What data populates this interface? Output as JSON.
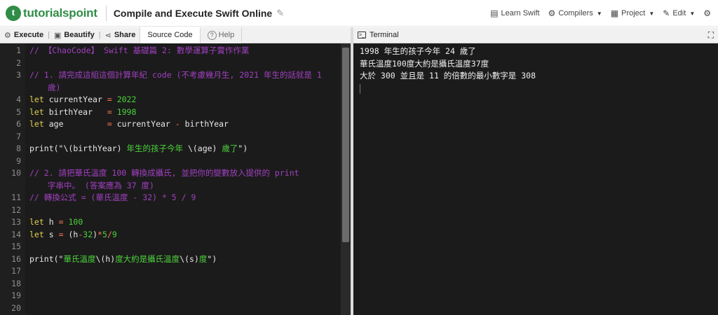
{
  "header": {
    "logo_text": "tutorialspoint",
    "title": "Compile and Execute Swift Online",
    "nav": [
      {
        "label": "Learn Swift",
        "icon": "book-icon"
      },
      {
        "label": "Compilers",
        "icon": "gear-icon"
      },
      {
        "label": "Project",
        "icon": "grid-icon"
      },
      {
        "label": "Edit",
        "icon": "edit-icon"
      }
    ]
  },
  "toolbar": {
    "execute_label": "Execute",
    "beautify_label": "Beautify",
    "share_label": "Share",
    "source_code_tab": "Source Code",
    "help_tab": "Help"
  },
  "terminal": {
    "title": "Terminal",
    "output": [
      "1998 年生的孩子今年 24 歲了",
      "華氏溫度100度大約是攝氏溫度37度",
      "大於 300 並且是 11 的倍數的最小數字是 308"
    ]
  },
  "editor": {
    "line_numbers": [
      "1",
      "2",
      "3",
      "4",
      "5",
      "6",
      "7",
      "8",
      "9",
      "10",
      "11",
      "12",
      "13",
      "14",
      "15",
      "16",
      "17",
      "18",
      "19",
      "20"
    ],
    "lines": {
      "l1": "// 【ChaoCode】 Swift 基礎篇 2: 數學運算子實作作業",
      "l3a": "// 1. 請完成這組這個計算年紀 code (不考慮幾月生, 2021 年生的話就是 1",
      "l3b": "歲)",
      "l4_kw": "let",
      "l4_id": "currentYear",
      "l4_op": "=",
      "l4_num": "2022",
      "l5_kw": "let",
      "l5_id": "birthYear",
      "l5_op": "=",
      "l5_num": "1998",
      "l6_kw": "let",
      "l6_id": "age",
      "l6_op": "=",
      "l6_a": "currentYear",
      "l6_minus": "-",
      "l6_b": "birthYear",
      "l8_fn": "print(",
      "l8_q": "\"",
      "l8_i1": "\\(birthYear)",
      "l8_s1": " 年生的孩子今年 ",
      "l8_i2": "\\(age)",
      "l8_s2": " 歲了",
      "l8_end": "\")",
      "l10a": "// 2. 請把華氏溫度 100 轉換成攝氏, 並把你的變數放入提供的 print",
      "l10b": "字串中。 (答案應為 37 度)",
      "l11": "// 轉換公式 = (華氏溫度 - 32) * 5 / 9",
      "l13_kw": "let",
      "l13_id": "h",
      "l13_op": "=",
      "l13_num": "100",
      "l14_kw": "let",
      "l14_id": "s",
      "l14_op": "=",
      "l14_p1": "(h",
      "l14_m": "-",
      "l14_n32": "32",
      "l14_p2": ")",
      "l14_star": "*",
      "l14_n5": "5",
      "l14_slash": "/",
      "l14_n9": "9",
      "l16_fn": "print(",
      "l16_q": "\"",
      "l16_s1": "華氏溫度",
      "l16_i1": "\\(h)",
      "l16_s2": "度大約是攝氏溫度",
      "l16_i2": "\\(s)",
      "l16_s3": "度",
      "l16_end": "\")"
    }
  },
  "colors": {
    "brand": "#2f8d46",
    "editor_bg": "#1b1b1b",
    "comment": "#a040c0",
    "keyword": "#e0d050",
    "string": "#4cd23c",
    "operator": "#ff7a4d"
  }
}
